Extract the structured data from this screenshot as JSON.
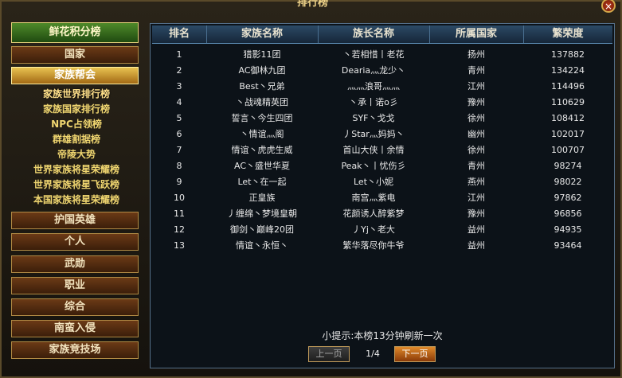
{
  "window": {
    "title": "排行榜",
    "close_label": "×"
  },
  "sidebar": {
    "top_button": "鲜花积分榜",
    "items": [
      {
        "label": "国家"
      },
      {
        "label": "家族帮会"
      }
    ],
    "sub_items": [
      {
        "label": "家族世界排行榜"
      },
      {
        "label": "家族国家排行榜"
      },
      {
        "label": "NPC占领榜"
      },
      {
        "label": "群雄割据榜"
      },
      {
        "label": "帝陵大势"
      },
      {
        "label": "世界家族将星荣耀榜"
      },
      {
        "label": "世界家族将星飞跃榜"
      },
      {
        "label": "本国家族将星荣耀榜"
      }
    ],
    "bottom_items": [
      {
        "label": "护国英雄"
      },
      {
        "label": "个人"
      },
      {
        "label": "武勋"
      },
      {
        "label": "职业"
      },
      {
        "label": "综合"
      },
      {
        "label": "南蛮入侵"
      },
      {
        "label": "家族竞技场"
      }
    ]
  },
  "table": {
    "headers": [
      "排名",
      "家族名称",
      "族长名称",
      "所属国家",
      "繁荣度"
    ],
    "rows": [
      [
        "1",
        "猎影11团",
        "丶若相惜丨老花",
        "扬州",
        "137882"
      ],
      [
        "2",
        "AC御林九团",
        "Dearia灬龙少丶",
        "青州",
        "134224"
      ],
      [
        "3",
        "Best丶兄弟",
        "灬灬浪哥灬灬",
        "江州",
        "114496"
      ],
      [
        "4",
        "丶战魂精英团",
        "丶承丨诺o彡",
        "豫州",
        "110629"
      ],
      [
        "5",
        "誓言丶今生四团",
        "SYF丶戈戈",
        "徐州",
        "108412"
      ],
      [
        "6",
        "丶情谊灬阁",
        "丿Star灬妈妈丶",
        "幽州",
        "102017"
      ],
      [
        "7",
        "情谊丶虎虎生威",
        "首山大侠丨余情",
        "徐州",
        "100707"
      ],
      [
        "8",
        "AC丶盛世华夏",
        "Peak丶丨忧伤彡",
        "青州",
        "98274"
      ],
      [
        "9",
        "Let丶在一起",
        "Let丶小妮",
        "燕州",
        "98022"
      ],
      [
        "10",
        "正皇族",
        "南宫灬紫电",
        "江州",
        "97862"
      ],
      [
        "11",
        "丿缠绵丶梦境皇朝",
        "花颜诱人醉紫梦",
        "豫州",
        "96856"
      ],
      [
        "12",
        "御剑丶巅峰20团",
        "丿Yj丶老大",
        "益州",
        "94935"
      ],
      [
        "13",
        "情谊丶永恒丶",
        "繁华落尽你牛爷",
        "益州",
        "93464"
      ]
    ]
  },
  "footer": {
    "tip": "小提示:本榜13分钟刷新一次",
    "prev_label": "上一页",
    "next_label": "下一页",
    "page_indicator": "1/4"
  }
}
